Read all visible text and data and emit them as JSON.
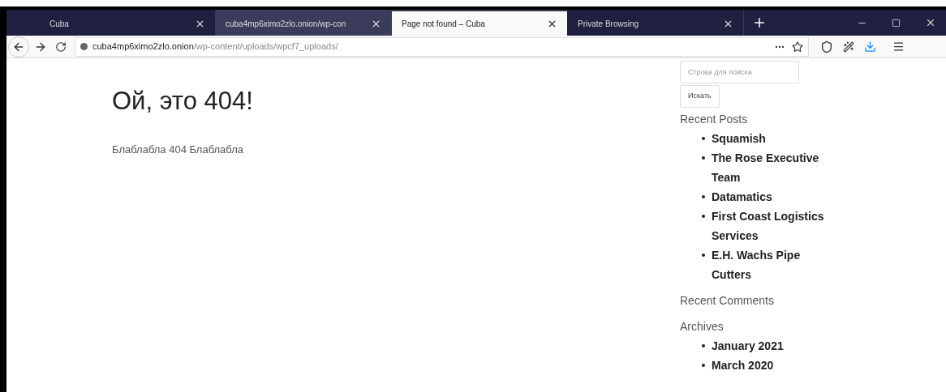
{
  "tabs": [
    {
      "title": "Cuba",
      "selected": false
    },
    {
      "title": "cuba4mp6ximo2zlo.onion/wp-con",
      "selected": false
    },
    {
      "title": "Page not found – Cuba",
      "selected": true
    },
    {
      "title": "Private Browsing",
      "selected": false
    }
  ],
  "address_bar": {
    "host": "cuba4mp6ximo2zlo.onion",
    "path": "/wp-content/uploads/wpcf7_uploads/"
  },
  "page": {
    "heading": "Ой, это 404!",
    "text": "Блаблабла 404 Блаблабла"
  },
  "sidebar": {
    "search": {
      "placeholder": "Строка для поиска"
    },
    "search_button": "Искать",
    "sections": [
      {
        "title": "Recent Posts",
        "items": [
          "Squamish",
          "The Rose Executive Team",
          "Datamatics",
          "First Coast Logistics Services",
          "E.H. Wachs Pipe Cutters"
        ]
      },
      {
        "title": "Recent Comments"
      },
      {
        "title": "Archives",
        "items": [
          "January 2021",
          "March 2020"
        ]
      }
    ]
  }
}
